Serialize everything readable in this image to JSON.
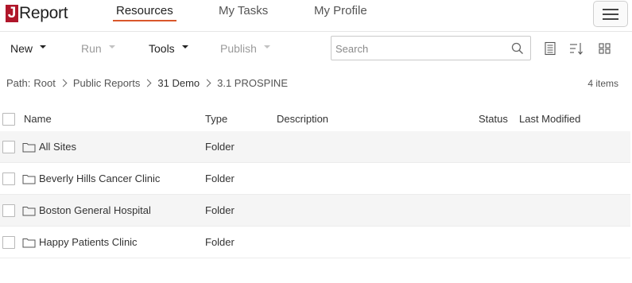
{
  "app": {
    "logo_letter": "J",
    "logo_text": "Report",
    "brand_color": "#b0162a",
    "accent_color": "#d9572b"
  },
  "nav": {
    "tabs": [
      {
        "label": "Resources",
        "active": true
      },
      {
        "label": "My Tasks",
        "active": false
      },
      {
        "label": "My Profile",
        "active": false
      }
    ],
    "menu_icon": "hamburger-menu-icon"
  },
  "toolbar": {
    "new_label": "New",
    "run_label": "Run",
    "tools_label": "Tools",
    "publish_label": "Publish",
    "run_disabled": true,
    "publish_disabled": true
  },
  "search": {
    "placeholder": "Search",
    "value": "",
    "icon": "search-icon"
  },
  "view_icons": [
    "list-view-icon",
    "sort-icon",
    "grid-view-icon"
  ],
  "breadcrumb": {
    "prefix": "Path:",
    "items": [
      "Root",
      "Public Reports",
      "31 Demo",
      "3.1 PROSPINE"
    ]
  },
  "item_count": "4 items",
  "table": {
    "columns": [
      "Name",
      "Type",
      "Description",
      "Status",
      "Last Modified"
    ],
    "rows": [
      {
        "name": "All Sites",
        "type": "Folder",
        "description": "",
        "status": "",
        "last_modified": ""
      },
      {
        "name": "Beverly Hills Cancer Clinic",
        "type": "Folder",
        "description": "",
        "status": "",
        "last_modified": ""
      },
      {
        "name": "Boston General Hospital",
        "type": "Folder",
        "description": "",
        "status": "",
        "last_modified": ""
      },
      {
        "name": "Happy Patients Clinic",
        "type": "Folder",
        "description": "",
        "status": "",
        "last_modified": ""
      }
    ]
  }
}
